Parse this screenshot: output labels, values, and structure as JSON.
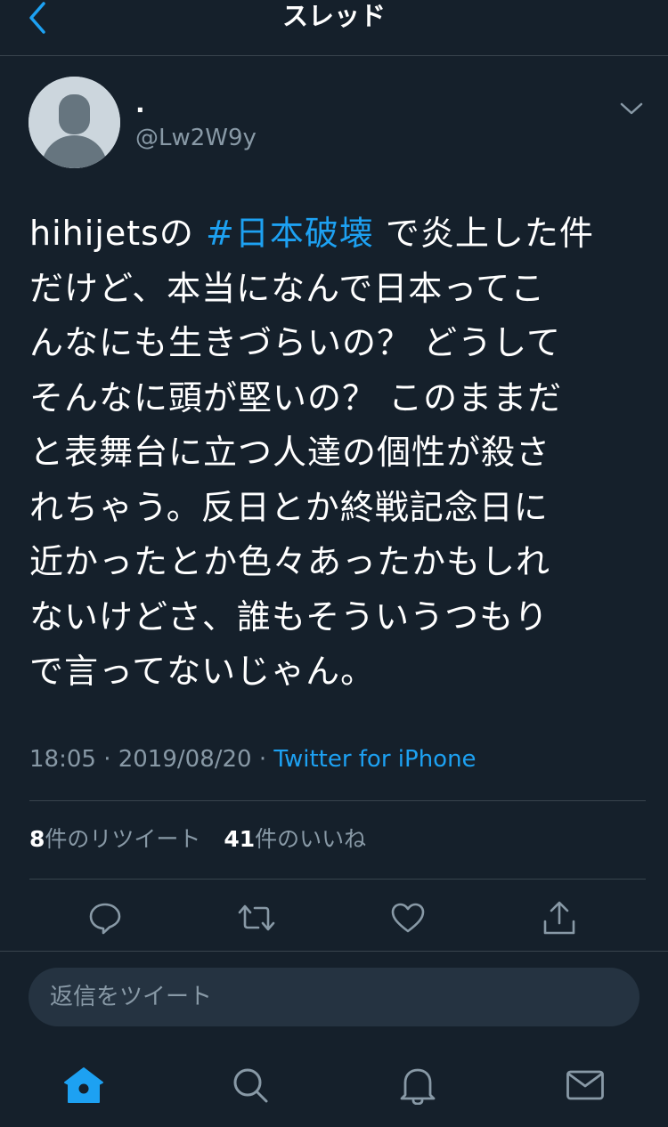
{
  "header": {
    "title": "スレッド",
    "back_icon": "chevron-left-icon"
  },
  "tweet": {
    "display_name": ".",
    "handle": "@Lw2W9y",
    "text_before": "hihijetsの ",
    "hashtag": "#日本破壊",
    "text_after": " で炎上した件\nだけど、本当になんで日本ってこ\nんなにも生きづらいの？ どうして\nそんなに頭が堅いの？ このままだ\nと表舞台に立つ人達の個性が殺さ\nれちゃう。反日とか終戦記念日に\n近かったとか色々あったかもしれ\nないけどさ、誰もそういうつもり\nで言ってないじゃん。",
    "timestamp": "18:05 · 2019/08/20 · ",
    "source": "Twitter for iPhone"
  },
  "stats": {
    "retweets_count": "8",
    "retweets_label": "件のリツイート",
    "likes_count": "41",
    "likes_label": "件のいいね"
  },
  "actions": [
    "reply-icon",
    "retweet-icon",
    "like-icon",
    "share-icon"
  ],
  "reply": {
    "placeholder": "返信をツイート"
  },
  "tabbar": [
    "home-icon",
    "search-icon",
    "notifications-icon",
    "messages-icon"
  ],
  "colors": {
    "background": "#15202b",
    "accent": "#1da1f2",
    "secondary_text": "#8899a6",
    "divider": "#38444d",
    "reply_box": "#253341"
  }
}
